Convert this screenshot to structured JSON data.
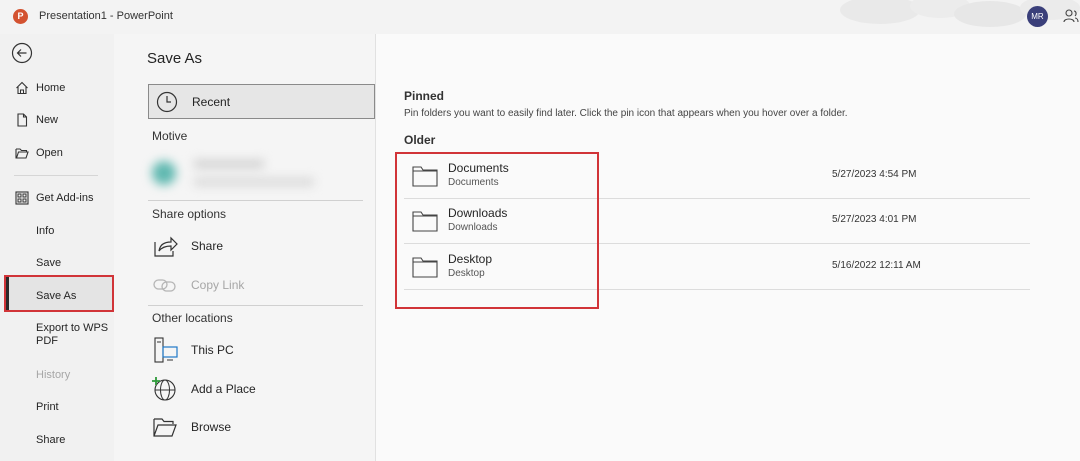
{
  "titlebar": {
    "app_icon_letter": "P",
    "title": "Presentation1  -  PowerPoint",
    "avatar_initials": "MR"
  },
  "nav": {
    "items": [
      {
        "label": "Home",
        "icon": "home-icon"
      },
      {
        "label": "New",
        "icon": "new-document-icon"
      },
      {
        "label": "Open",
        "icon": "open-folder-icon"
      },
      {
        "label": "Get Add-ins",
        "icon": "add-ins-icon"
      },
      {
        "label": "Info"
      },
      {
        "label": "Save"
      },
      {
        "label": "Save As",
        "selected": true
      },
      {
        "label_line1": "Export to WPS",
        "label_line2": "PDF"
      },
      {
        "label": "History",
        "disabled": true
      },
      {
        "label": "Print"
      },
      {
        "label": "Share"
      }
    ]
  },
  "page": {
    "title": "Save As"
  },
  "locations": {
    "recent_label": "Recent",
    "account_section": "Motive",
    "share_section": "Share options",
    "share_label": "Share",
    "copy_link_label": "Copy Link",
    "other_section": "Other locations",
    "this_pc_label": "This PC",
    "add_place_label": "Add a Place",
    "browse_label": "Browse"
  },
  "right": {
    "pinned_title": "Pinned",
    "pinned_desc": "Pin folders you want to easily find later. Click the pin icon that appears when you hover over a folder.",
    "older_title": "Older",
    "folders": [
      {
        "name": "Documents",
        "path": "Documents",
        "date": "5/27/2023 4:54 PM"
      },
      {
        "name": "Downloads",
        "path": "Downloads",
        "date": "5/27/2023 4:01 PM"
      },
      {
        "name": "Desktop",
        "path": "Desktop",
        "date": "5/16/2022 12:11 AM"
      }
    ]
  },
  "colors": {
    "accent_red": "#d13438",
    "powerpoint_orange": "#d35230",
    "avatar_bg": "#3a3f7a"
  }
}
